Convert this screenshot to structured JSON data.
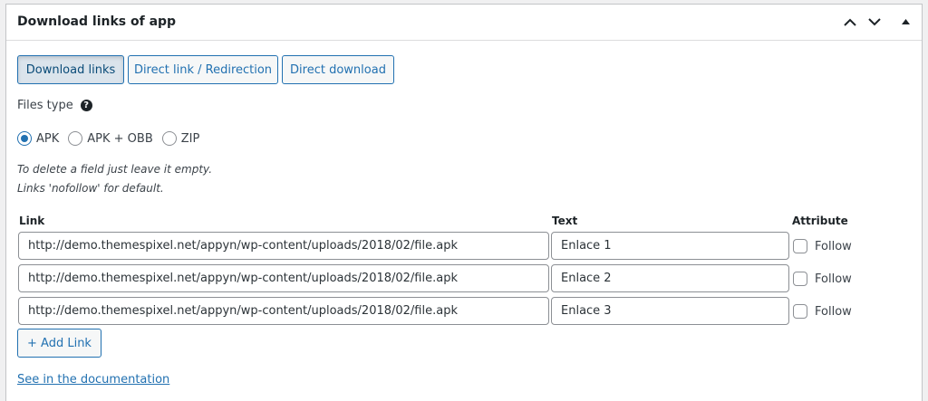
{
  "metabox": {
    "title": "Download links of app",
    "header_icons": [
      "chevron-up-icon",
      "chevron-down-icon",
      "triangle-up-icon"
    ]
  },
  "tabs": [
    {
      "label": "Download links",
      "active": true
    },
    {
      "label": "Direct link / Redirection",
      "active": false
    },
    {
      "label": "Direct download",
      "active": false
    }
  ],
  "files_type": {
    "label": "Files type",
    "help_icon": "?",
    "options": [
      {
        "label": "APK",
        "checked": true
      },
      {
        "label": "APK + OBB",
        "checked": false
      },
      {
        "label": "ZIP",
        "checked": false
      }
    ]
  },
  "notes": [
    "To delete a field just leave it empty.",
    "Links 'nofollow' for default."
  ],
  "table": {
    "headers": {
      "link": "Link",
      "text": "Text",
      "attribute": "Attribute"
    },
    "rows": [
      {
        "link": "http://demo.themespixel.net/appyn/wp-content/uploads/2018/02/file.apk",
        "text": "Enlace 1",
        "follow_label": "Follow",
        "follow": false
      },
      {
        "link": "http://demo.themespixel.net/appyn/wp-content/uploads/2018/02/file.apk",
        "text": "Enlace 2",
        "follow_label": "Follow",
        "follow": false
      },
      {
        "link": "http://demo.themespixel.net/appyn/wp-content/uploads/2018/02/file.apk",
        "text": "Enlace 3",
        "follow_label": "Follow",
        "follow": false
      }
    ]
  },
  "add_link_label": "+ Add Link",
  "documentation_link": "See in the documentation",
  "colors": {
    "accent": "#2271b1",
    "border": "#8c8f94",
    "text": "#3c434a"
  }
}
